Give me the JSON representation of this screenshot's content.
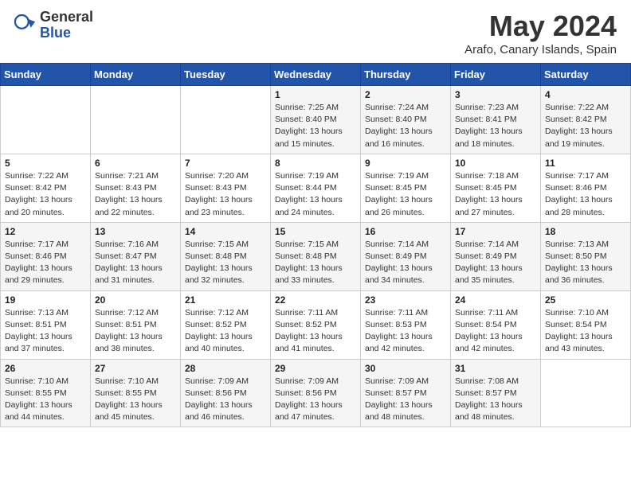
{
  "header": {
    "logo_general": "General",
    "logo_blue": "Blue",
    "title": "May 2024",
    "subtitle": "Arafo, Canary Islands, Spain"
  },
  "weekdays": [
    "Sunday",
    "Monday",
    "Tuesday",
    "Wednesday",
    "Thursday",
    "Friday",
    "Saturday"
  ],
  "weeks": [
    [
      {
        "day": "",
        "sunrise": "",
        "sunset": "",
        "daylight": ""
      },
      {
        "day": "",
        "sunrise": "",
        "sunset": "",
        "daylight": ""
      },
      {
        "day": "",
        "sunrise": "",
        "sunset": "",
        "daylight": ""
      },
      {
        "day": "1",
        "sunrise": "Sunrise: 7:25 AM",
        "sunset": "Sunset: 8:40 PM",
        "daylight": "Daylight: 13 hours and 15 minutes."
      },
      {
        "day": "2",
        "sunrise": "Sunrise: 7:24 AM",
        "sunset": "Sunset: 8:40 PM",
        "daylight": "Daylight: 13 hours and 16 minutes."
      },
      {
        "day": "3",
        "sunrise": "Sunrise: 7:23 AM",
        "sunset": "Sunset: 8:41 PM",
        "daylight": "Daylight: 13 hours and 18 minutes."
      },
      {
        "day": "4",
        "sunrise": "Sunrise: 7:22 AM",
        "sunset": "Sunset: 8:42 PM",
        "daylight": "Daylight: 13 hours and 19 minutes."
      }
    ],
    [
      {
        "day": "5",
        "sunrise": "Sunrise: 7:22 AM",
        "sunset": "Sunset: 8:42 PM",
        "daylight": "Daylight: 13 hours and 20 minutes."
      },
      {
        "day": "6",
        "sunrise": "Sunrise: 7:21 AM",
        "sunset": "Sunset: 8:43 PM",
        "daylight": "Daylight: 13 hours and 22 minutes."
      },
      {
        "day": "7",
        "sunrise": "Sunrise: 7:20 AM",
        "sunset": "Sunset: 8:43 PM",
        "daylight": "Daylight: 13 hours and 23 minutes."
      },
      {
        "day": "8",
        "sunrise": "Sunrise: 7:19 AM",
        "sunset": "Sunset: 8:44 PM",
        "daylight": "Daylight: 13 hours and 24 minutes."
      },
      {
        "day": "9",
        "sunrise": "Sunrise: 7:19 AM",
        "sunset": "Sunset: 8:45 PM",
        "daylight": "Daylight: 13 hours and 26 minutes."
      },
      {
        "day": "10",
        "sunrise": "Sunrise: 7:18 AM",
        "sunset": "Sunset: 8:45 PM",
        "daylight": "Daylight: 13 hours and 27 minutes."
      },
      {
        "day": "11",
        "sunrise": "Sunrise: 7:17 AM",
        "sunset": "Sunset: 8:46 PM",
        "daylight": "Daylight: 13 hours and 28 minutes."
      }
    ],
    [
      {
        "day": "12",
        "sunrise": "Sunrise: 7:17 AM",
        "sunset": "Sunset: 8:46 PM",
        "daylight": "Daylight: 13 hours and 29 minutes."
      },
      {
        "day": "13",
        "sunrise": "Sunrise: 7:16 AM",
        "sunset": "Sunset: 8:47 PM",
        "daylight": "Daylight: 13 hours and 31 minutes."
      },
      {
        "day": "14",
        "sunrise": "Sunrise: 7:15 AM",
        "sunset": "Sunset: 8:48 PM",
        "daylight": "Daylight: 13 hours and 32 minutes."
      },
      {
        "day": "15",
        "sunrise": "Sunrise: 7:15 AM",
        "sunset": "Sunset: 8:48 PM",
        "daylight": "Daylight: 13 hours and 33 minutes."
      },
      {
        "day": "16",
        "sunrise": "Sunrise: 7:14 AM",
        "sunset": "Sunset: 8:49 PM",
        "daylight": "Daylight: 13 hours and 34 minutes."
      },
      {
        "day": "17",
        "sunrise": "Sunrise: 7:14 AM",
        "sunset": "Sunset: 8:49 PM",
        "daylight": "Daylight: 13 hours and 35 minutes."
      },
      {
        "day": "18",
        "sunrise": "Sunrise: 7:13 AM",
        "sunset": "Sunset: 8:50 PM",
        "daylight": "Daylight: 13 hours and 36 minutes."
      }
    ],
    [
      {
        "day": "19",
        "sunrise": "Sunrise: 7:13 AM",
        "sunset": "Sunset: 8:51 PM",
        "daylight": "Daylight: 13 hours and 37 minutes."
      },
      {
        "day": "20",
        "sunrise": "Sunrise: 7:12 AM",
        "sunset": "Sunset: 8:51 PM",
        "daylight": "Daylight: 13 hours and 38 minutes."
      },
      {
        "day": "21",
        "sunrise": "Sunrise: 7:12 AM",
        "sunset": "Sunset: 8:52 PM",
        "daylight": "Daylight: 13 hours and 40 minutes."
      },
      {
        "day": "22",
        "sunrise": "Sunrise: 7:11 AM",
        "sunset": "Sunset: 8:52 PM",
        "daylight": "Daylight: 13 hours and 41 minutes."
      },
      {
        "day": "23",
        "sunrise": "Sunrise: 7:11 AM",
        "sunset": "Sunset: 8:53 PM",
        "daylight": "Daylight: 13 hours and 42 minutes."
      },
      {
        "day": "24",
        "sunrise": "Sunrise: 7:11 AM",
        "sunset": "Sunset: 8:54 PM",
        "daylight": "Daylight: 13 hours and 42 minutes."
      },
      {
        "day": "25",
        "sunrise": "Sunrise: 7:10 AM",
        "sunset": "Sunset: 8:54 PM",
        "daylight": "Daylight: 13 hours and 43 minutes."
      }
    ],
    [
      {
        "day": "26",
        "sunrise": "Sunrise: 7:10 AM",
        "sunset": "Sunset: 8:55 PM",
        "daylight": "Daylight: 13 hours and 44 minutes."
      },
      {
        "day": "27",
        "sunrise": "Sunrise: 7:10 AM",
        "sunset": "Sunset: 8:55 PM",
        "daylight": "Daylight: 13 hours and 45 minutes."
      },
      {
        "day": "28",
        "sunrise": "Sunrise: 7:09 AM",
        "sunset": "Sunset: 8:56 PM",
        "daylight": "Daylight: 13 hours and 46 minutes."
      },
      {
        "day": "29",
        "sunrise": "Sunrise: 7:09 AM",
        "sunset": "Sunset: 8:56 PM",
        "daylight": "Daylight: 13 hours and 47 minutes."
      },
      {
        "day": "30",
        "sunrise": "Sunrise: 7:09 AM",
        "sunset": "Sunset: 8:57 PM",
        "daylight": "Daylight: 13 hours and 48 minutes."
      },
      {
        "day": "31",
        "sunrise": "Sunrise: 7:08 AM",
        "sunset": "Sunset: 8:57 PM",
        "daylight": "Daylight: 13 hours and 48 minutes."
      },
      {
        "day": "",
        "sunrise": "",
        "sunset": "",
        "daylight": ""
      }
    ]
  ]
}
